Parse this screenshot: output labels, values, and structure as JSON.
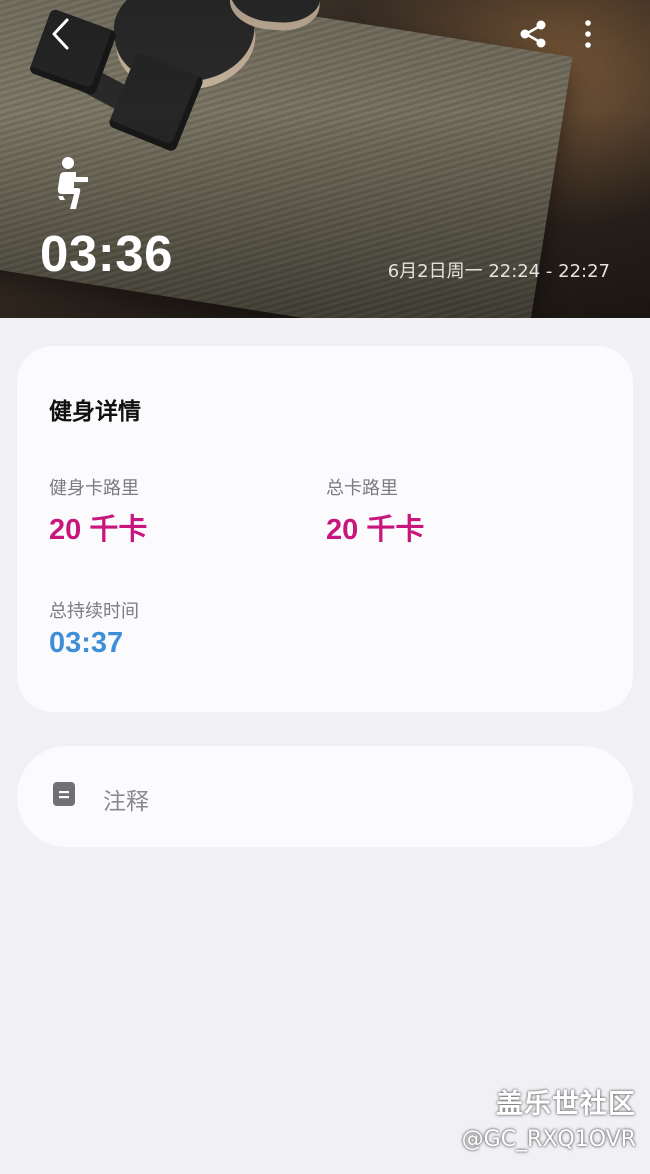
{
  "hero": {
    "duration": "03:36",
    "time_range": "6月2日周一 22:24 - 22:27",
    "workout_icon": "squat-person-icon",
    "actions": {
      "back_icon": "chevron-left-icon",
      "share_icon": "share-icon",
      "more_icon": "more-vertical-icon"
    }
  },
  "details": {
    "title": "健身详情",
    "workout_calories_label": "健身卡路里",
    "workout_calories_value": "20 千卡",
    "total_calories_label": "总卡路里",
    "total_calories_value": "20 千卡",
    "total_duration_label": "总持续时间",
    "total_duration_value": "03:37"
  },
  "notes": {
    "icon": "note-icon",
    "label": "注释"
  },
  "watermark": {
    "title": "盖乐世社区",
    "handle": "@GC_RXQ1OVR"
  },
  "colors": {
    "calories": "#c8167d",
    "duration": "#3f8fd8",
    "background": "#f1f0f5",
    "card": "#fbfbfe"
  }
}
